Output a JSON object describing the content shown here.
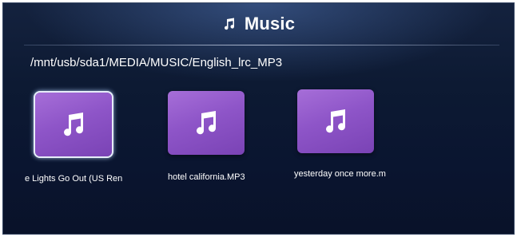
{
  "header": {
    "title": "Music",
    "icon": "music-note-icon"
  },
  "path": "/mnt/usb/sda1/MEDIA/MUSIC/English_lrc_MP3",
  "files": [
    {
      "name": "e Lights Go Out (US Ren",
      "icon": "music-note-icon",
      "selected": true
    },
    {
      "name": "hotel california.MP3",
      "icon": "music-note-icon",
      "selected": false
    },
    {
      "name": "yesterday once more.m",
      "icon": "music-note-icon",
      "selected": false
    }
  ],
  "colors": {
    "tile": "#8e55c8",
    "background": "#0d1a33",
    "text": "#ffffff"
  }
}
